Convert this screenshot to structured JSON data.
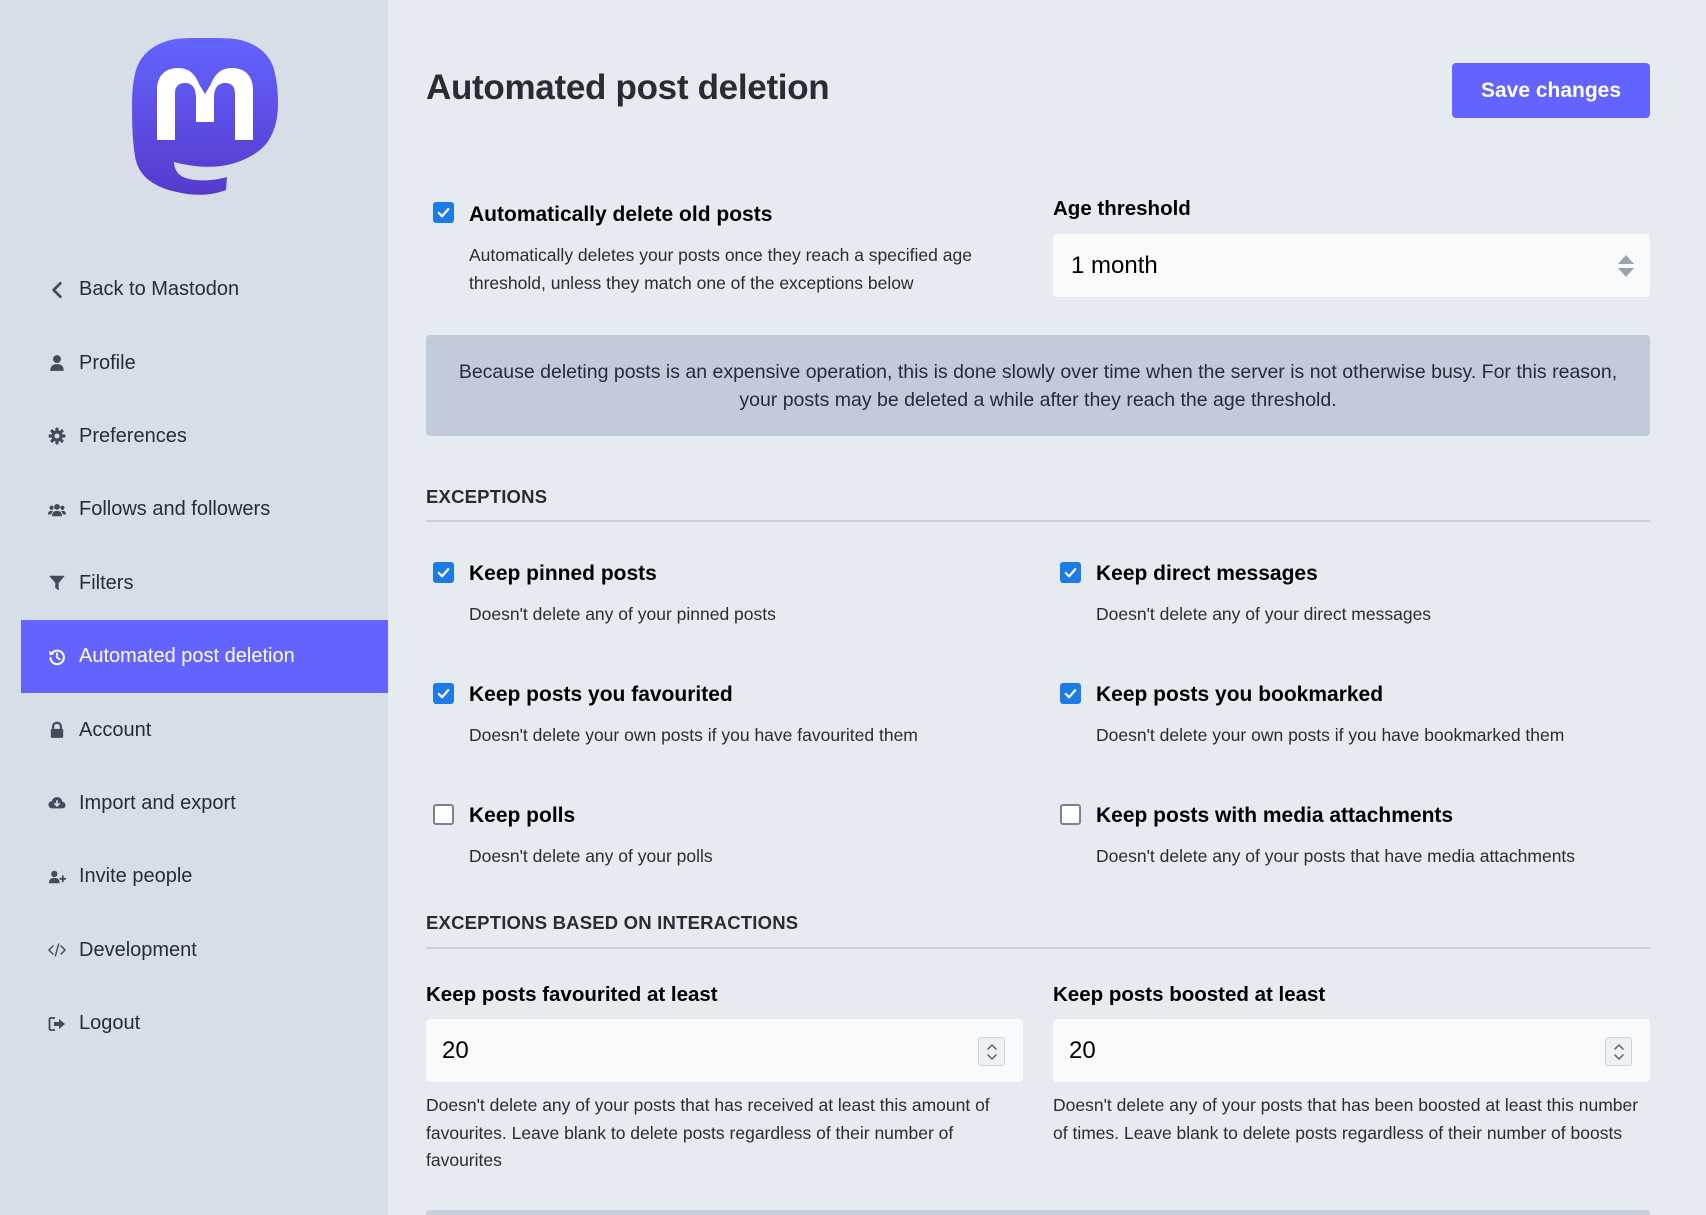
{
  "page": {
    "title": "Automated post deletion",
    "save_label": "Save changes"
  },
  "sidebar": {
    "logo_icon": "mastodon-logo-icon",
    "brand_color": "#6364ff",
    "items": [
      {
        "label": "Back to Mastodon",
        "icon": "chevron-left-icon"
      },
      {
        "label": "Profile",
        "icon": "user-icon"
      },
      {
        "label": "Preferences",
        "icon": "gear-icon"
      },
      {
        "label": "Follows and followers",
        "icon": "users-icon"
      },
      {
        "label": "Filters",
        "icon": "filter-icon"
      },
      {
        "label": "Automated post deletion",
        "icon": "history-icon",
        "active": true
      },
      {
        "label": "Account",
        "icon": "lock-icon"
      },
      {
        "label": "Import and export",
        "icon": "cloud-download-icon"
      },
      {
        "label": "Invite people",
        "icon": "user-plus-icon"
      },
      {
        "label": "Development",
        "icon": "code-icon"
      },
      {
        "label": "Logout",
        "icon": "sign-out-icon"
      }
    ]
  },
  "auto_delete": {
    "label": "Automatically delete old posts",
    "hint": "Automatically deletes your posts once they reach a specified age threshold, unless they match one of the exceptions below",
    "checked": true
  },
  "age_threshold": {
    "label": "Age threshold",
    "value": "1 month"
  },
  "warning": {
    "text": "Because deleting posts is an expensive operation, this is done slowly over time when the server is not otherwise busy. For this reason, your posts may be deleted a while after they reach the age threshold."
  },
  "exceptions": {
    "heading": "EXCEPTIONS",
    "items": [
      {
        "label": "Keep pinned posts",
        "hint": "Doesn't delete any of your pinned posts",
        "checked": true
      },
      {
        "label": "Keep direct messages",
        "hint": "Doesn't delete any of your direct messages",
        "checked": true
      },
      {
        "label": "Keep posts you favourited",
        "hint": "Doesn't delete your own posts if you have favourited them",
        "checked": true
      },
      {
        "label": "Keep posts you bookmarked",
        "hint": "Doesn't delete your own posts if you have bookmarked them",
        "checked": true
      },
      {
        "label": "Keep polls",
        "hint": "Doesn't delete any of your polls",
        "checked": false
      },
      {
        "label": "Keep posts with media attachments",
        "hint": "Doesn't delete any of your posts that have media attachments",
        "checked": false
      }
    ]
  },
  "interactions": {
    "heading": "EXCEPTIONS BASED ON INTERACTIONS",
    "favourites": {
      "label": "Keep posts favourited at least",
      "value": "20",
      "hint": "Doesn't delete any of your posts that has received at least this amount of favourites. Leave blank to delete posts regardless of their number of favourites"
    },
    "boosts": {
      "label": "Keep posts boosted at least",
      "value": "20",
      "hint": "Doesn't delete any of your posts that has been boosted at least this number of times. Leave blank to delete posts regardless of their number of boosts"
    }
  }
}
